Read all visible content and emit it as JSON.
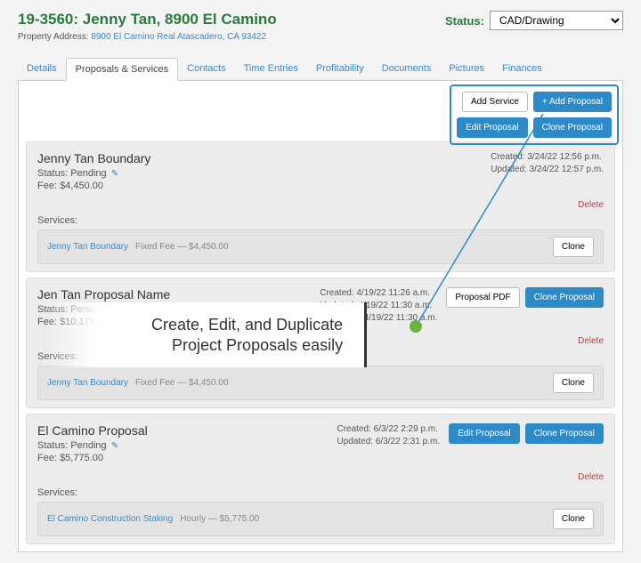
{
  "header": {
    "title": "19-3560: Jenny Tan, 8900 El Camino",
    "addr_label": "Property Address:",
    "addr": "8900 El Camino Real Atascadero, CA 93422",
    "status_label": "Status:",
    "status_value": "CAD/Drawing"
  },
  "tabs": [
    "Details",
    "Proposals & Services",
    "Contacts",
    "Time Entries",
    "Profitability",
    "Documents",
    "Pictures",
    "Finances"
  ],
  "actions": {
    "add_service": "Add Service",
    "add_proposal": "+ Add Proposal",
    "edit_proposal": "Edit Proposal",
    "clone_proposal": "Clone Proposal",
    "proposal_pdf": "Proposal PDF",
    "clone": "Clone",
    "delete": "Delete"
  },
  "labels": {
    "status": "Status:",
    "fee": "Fee:",
    "services": "Services:",
    "pending": "Pending"
  },
  "proposals": [
    {
      "name": "Jenny Tan Boundary",
      "fee": "$4,450.00",
      "created": "Created: 3/24/22 12:56 p.m.",
      "updated": "Updated: 3/24/22 12:57 p.m.",
      "published": "",
      "svc_name": "Jenny Tan Boundary",
      "svc_detail": "Fixed Fee — $4,450.00",
      "mode": "callout"
    },
    {
      "name": "Jen Tan Proposal Name",
      "fee": "$10,175.00",
      "created": "Created: 4/19/22 11:26 a.m.",
      "updated": "Updated: 4/19/22 11:30 a.m.",
      "published": "Published: 4/19/22 11:30 a.m.",
      "svc_name": "Jenny Tan Boundary",
      "svc_detail": "Fixed Fee — $4,450.00",
      "mode": "pdf"
    },
    {
      "name": "El Camino Proposal",
      "fee": "$5,775.00",
      "created": "Created: 6/3/22 2:29 p.m.",
      "updated": "Updated: 6/3/22 2:31 p.m.",
      "published": "",
      "svc_name": "El Camino Construction Staking",
      "svc_detail": "Hourly — $5,775.00",
      "mode": "edit"
    }
  ],
  "annotation": {
    "line1": "Create, Edit, and Duplicate",
    "line2": "Project Proposals easily"
  }
}
